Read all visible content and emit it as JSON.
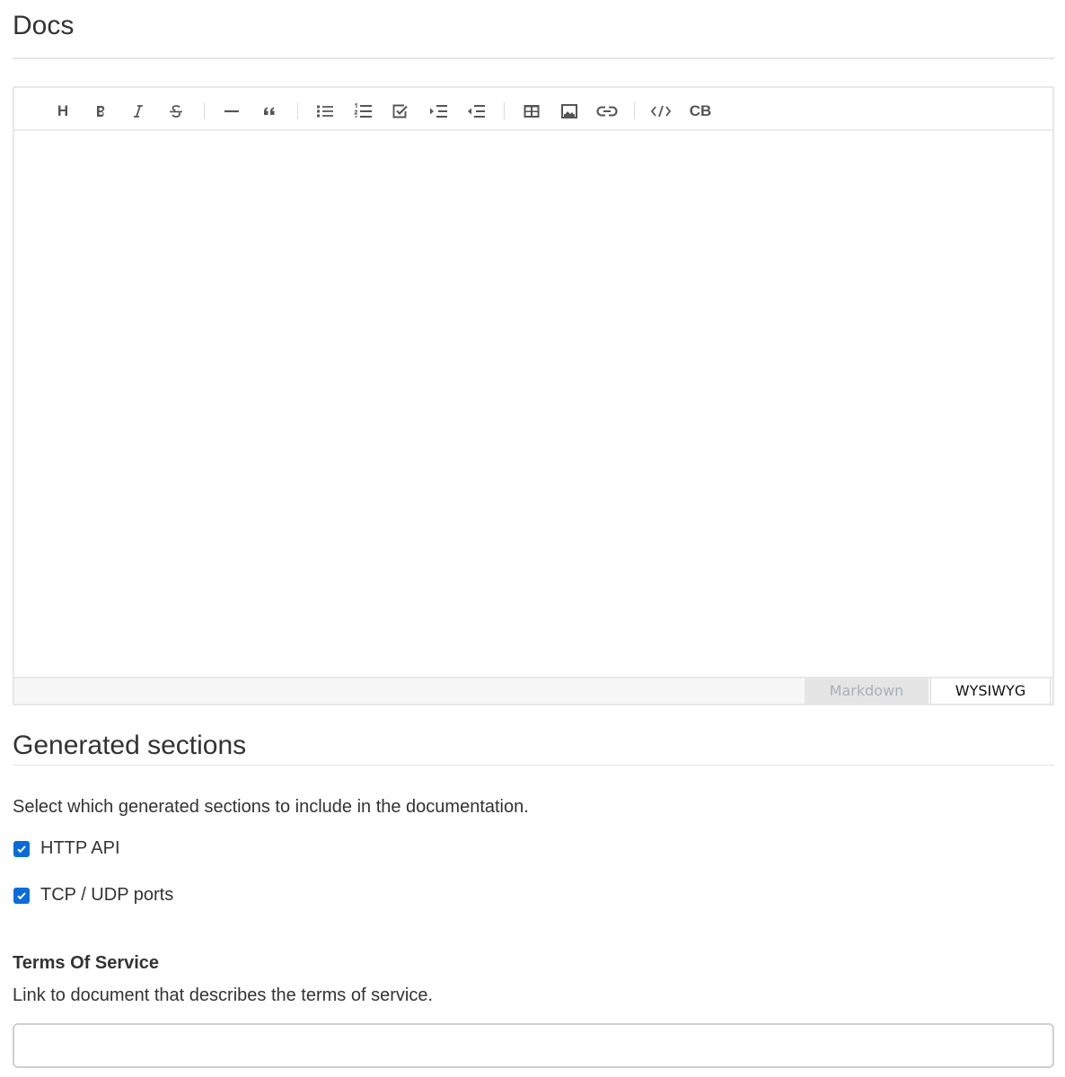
{
  "docs": {
    "title": "Docs"
  },
  "editor": {
    "toolbar": {
      "heading_glyph": "H",
      "codeblock_label": "CB",
      "buttons": [
        "heading",
        "bold",
        "italic",
        "strike",
        "hr",
        "quote",
        "bullet-list",
        "ordered-list",
        "task-list",
        "indent",
        "outdent",
        "table",
        "image",
        "link",
        "code",
        "codeblock"
      ]
    },
    "modes": {
      "markdown": "Markdown",
      "wysiwyg": "WYSIWYG",
      "active": "WYSIWYG"
    }
  },
  "generated": {
    "title": "Generated sections",
    "description": "Select which generated sections to include in the documentation.",
    "options": [
      {
        "label": "HTTP API",
        "checked": true
      },
      {
        "label": "TCP / UDP ports",
        "checked": true
      }
    ]
  },
  "terms": {
    "label": "Terms Of Service",
    "description": "Link to document that describes the terms of service.",
    "value": ""
  },
  "colors": {
    "checkbox": "#0a6cd8",
    "text": "#333333",
    "border": "#e7e7e7"
  }
}
